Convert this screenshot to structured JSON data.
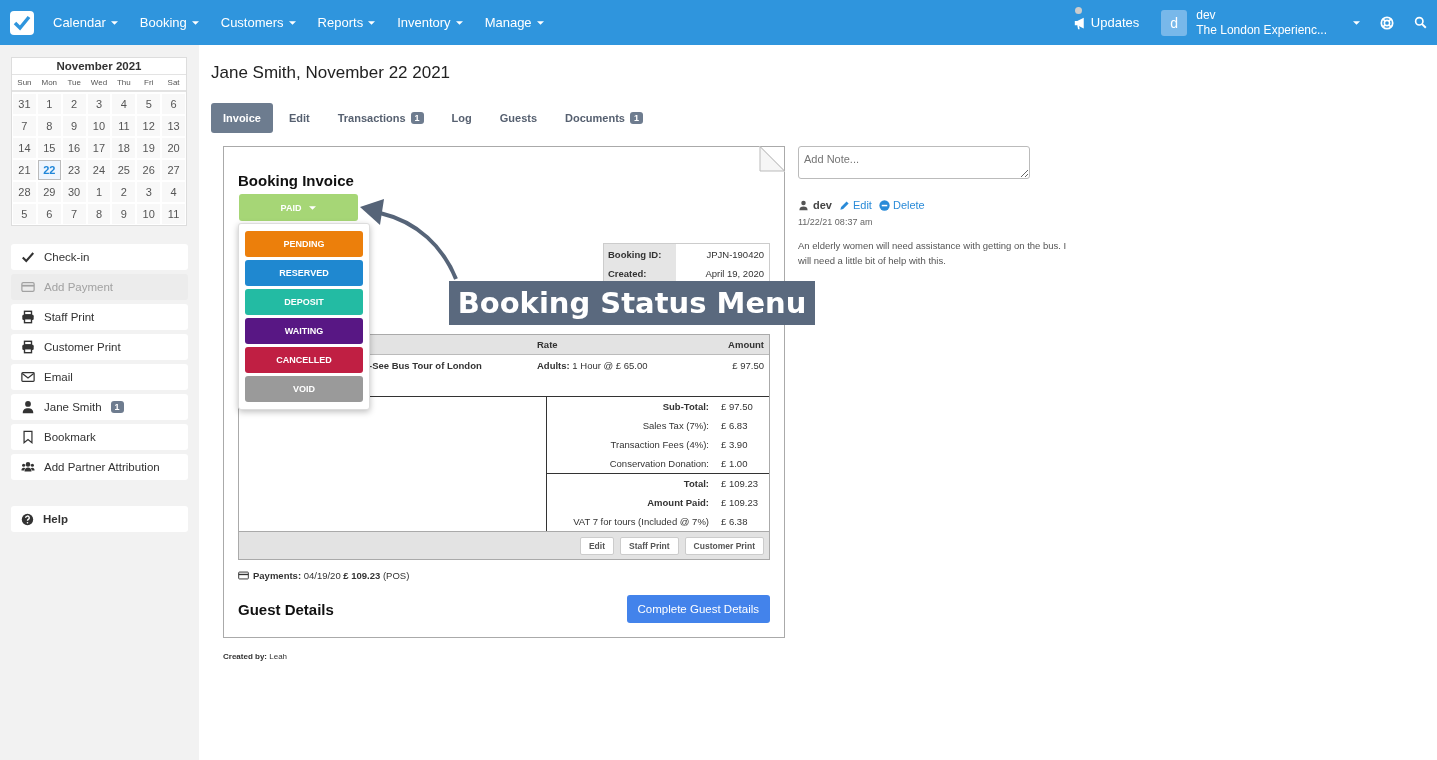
{
  "nav": {
    "menus": [
      {
        "label": "Calendar"
      },
      {
        "label": "Booking"
      },
      {
        "label": "Customers"
      },
      {
        "label": "Reports"
      },
      {
        "label": "Inventory"
      },
      {
        "label": "Manage"
      }
    ],
    "updates": "Updates",
    "user": {
      "initial": "d",
      "name": "dev",
      "org": "The London Experienc..."
    }
  },
  "calendar": {
    "title": "November 2021",
    "weekdays": [
      "Sun",
      "Mon",
      "Tue",
      "Wed",
      "Thu",
      "Fri",
      "Sat"
    ],
    "days": [
      {
        "label": "31",
        "selected": false
      },
      {
        "label": "1",
        "selected": false
      },
      {
        "label": "2",
        "selected": false
      },
      {
        "label": "3",
        "selected": false
      },
      {
        "label": "4",
        "selected": false
      },
      {
        "label": "5",
        "selected": false
      },
      {
        "label": "6",
        "selected": false
      },
      {
        "label": "7",
        "selected": false
      },
      {
        "label": "8",
        "selected": false
      },
      {
        "label": "9",
        "selected": false
      },
      {
        "label": "10",
        "selected": false
      },
      {
        "label": "11",
        "selected": false
      },
      {
        "label": "12",
        "selected": false
      },
      {
        "label": "13",
        "selected": false
      },
      {
        "label": "14",
        "selected": false
      },
      {
        "label": "15",
        "selected": false
      },
      {
        "label": "16",
        "selected": false
      },
      {
        "label": "17",
        "selected": false
      },
      {
        "label": "18",
        "selected": false
      },
      {
        "label": "19",
        "selected": false
      },
      {
        "label": "20",
        "selected": false
      },
      {
        "label": "21",
        "selected": false
      },
      {
        "label": "22",
        "selected": true
      },
      {
        "label": "23",
        "selected": false
      },
      {
        "label": "24",
        "selected": false
      },
      {
        "label": "25",
        "selected": false
      },
      {
        "label": "26",
        "selected": false
      },
      {
        "label": "27",
        "selected": false
      },
      {
        "label": "28",
        "selected": false
      },
      {
        "label": "29",
        "selected": false
      },
      {
        "label": "30",
        "selected": false
      },
      {
        "label": "1",
        "selected": false
      },
      {
        "label": "2",
        "selected": false
      },
      {
        "label": "3",
        "selected": false
      },
      {
        "label": "4",
        "selected": false
      },
      {
        "label": "5",
        "selected": false
      },
      {
        "label": "6",
        "selected": false
      },
      {
        "label": "7",
        "selected": false
      },
      {
        "label": "8",
        "selected": false
      },
      {
        "label": "9",
        "selected": false
      },
      {
        "label": "10",
        "selected": false
      },
      {
        "label": "11",
        "selected": false
      }
    ]
  },
  "actions": [
    {
      "label": "Check-in",
      "disabled": false
    },
    {
      "label": "Add Payment",
      "disabled": true
    },
    {
      "label": "Staff Print",
      "disabled": false
    },
    {
      "label": "Customer Print",
      "disabled": false
    },
    {
      "label": "Email",
      "disabled": false
    },
    {
      "label": "Jane Smith",
      "badge": "1",
      "disabled": false
    },
    {
      "label": "Bookmark",
      "disabled": false
    },
    {
      "label": "Add Partner Attribution",
      "disabled": false
    }
  ],
  "help": "Help",
  "page_title": "Jane Smith, November 22 2021",
  "tabs": [
    {
      "label": "Invoice",
      "selected": true
    },
    {
      "label": "Edit",
      "selected": false
    },
    {
      "label": "Transactions",
      "badge": "1",
      "selected": false
    },
    {
      "label": "Log",
      "selected": false
    },
    {
      "label": "Guests",
      "selected": false
    },
    {
      "label": "Documents",
      "badge": "1",
      "selected": false
    }
  ],
  "invoice": {
    "title": "Booking Invoice",
    "status": {
      "label": "PAID",
      "color": "#a6d676"
    },
    "status_menu": [
      {
        "label": "PENDING",
        "color": "#ec7f0b"
      },
      {
        "label": "RESERVED",
        "color": "#1f88d0"
      },
      {
        "label": "DEPOSIT",
        "color": "#23bba3"
      },
      {
        "label": "WAITING",
        "color": "#581784"
      },
      {
        "label": "CANCELLED",
        "color": "#c01f43"
      },
      {
        "label": "VOID",
        "color": "#9a9a9a"
      }
    ],
    "meta": [
      {
        "label": "Booking ID:",
        "value": "JPJN-190420"
      },
      {
        "label": "Created:",
        "value": "April 19, 2020"
      }
    ],
    "line_items": {
      "columns": [
        "Rate",
        "Amount"
      ],
      "rows": [
        {
          "description": "-See Bus Tour of London",
          "rate": "**Adults:** 1 Hour @ £ 65.00",
          "amount": "£ 97.50"
        }
      ]
    },
    "totals": [
      {
        "rows": [
          {
            "label": "Sub-Total:",
            "value": "£ 97.50",
            "bold": true
          },
          {
            "label": "Sales Tax (7%):",
            "value": "£ 6.83",
            "bold": false
          },
          {
            "label": "Transaction Fees (4%):",
            "value": "£ 3.90",
            "bold": false
          },
          {
            "label": "Conservation Donation:",
            "value": "£ 1.00",
            "bold": false
          }
        ]
      },
      {
        "rows": [
          {
            "label": "Total:",
            "value": "£ 109.23",
            "bold": true
          },
          {
            "label": "Amount Paid:",
            "value": "£ 109.23",
            "bold": true
          },
          {
            "label": "VAT 7 for tours (Included @ 7%)",
            "value": "£ 6.38",
            "bold": false
          }
        ]
      }
    ],
    "footer_buttons": [
      "Edit",
      "Staff Print",
      "Customer Print"
    ],
    "payments": "**Payments:** 04/19/20 **£ 109.23** (POS)",
    "guest_details": {
      "title": "Guest Details",
      "button": "Complete Guest Details"
    }
  },
  "created_by": "**Created by:** Leah",
  "notes": {
    "placeholder": "Add Note...",
    "items": [
      {
        "author": "dev",
        "edit": "Edit",
        "delete": "Delete",
        "time": "11/22/21 08:37 am",
        "text": "An elderly women will need assistance with getting on the bus. I will need a little bit of help with this."
      }
    ]
  },
  "callout": "Booking Status Menu"
}
